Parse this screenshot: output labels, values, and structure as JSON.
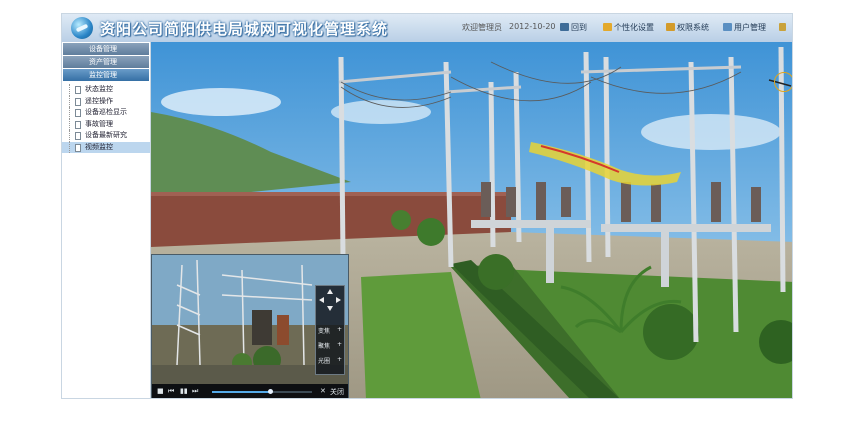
{
  "header": {
    "title": "资阳公司简阳供电局城网可视化管理系统",
    "user": "欢迎管理员",
    "date": "2012-10-20",
    "buttons": [
      {
        "label": "回到",
        "icon": "printer-icon"
      },
      {
        "label": "个性化设置",
        "icon": "folder-icon"
      },
      {
        "label": "权限系统",
        "icon": "key-icon"
      },
      {
        "label": "用户管理",
        "icon": "user-icon"
      }
    ],
    "colors": {
      "header_bg": "#cfdff0",
      "title": "#ffffff"
    }
  },
  "sidebar": {
    "sections": [
      {
        "label": "设备管理"
      },
      {
        "label": "资产管理"
      },
      {
        "label": "监控管理"
      }
    ],
    "items": [
      {
        "label": "状态监控"
      },
      {
        "label": "遥控操作"
      },
      {
        "label": "设备巡检显示"
      },
      {
        "label": "事故管理"
      },
      {
        "label": "设备最新研究"
      },
      {
        "label": "视频监控"
      }
    ],
    "selected_item": "视频监控",
    "colors": {
      "active": "#356fa4",
      "selected_bg": "#bcd6ee"
    }
  },
  "video": {
    "ptz": {
      "rows": [
        {
          "label": "变焦",
          "sign": "+"
        },
        {
          "label": "聚焦",
          "sign": "+"
        },
        {
          "label": "光圈",
          "sign": "+"
        }
      ]
    },
    "controls": {
      "stop": "■",
      "prev": "⏮",
      "pause": "▮▮",
      "next": "⏭",
      "close": "✕",
      "extra": "关闭"
    },
    "progress": 0.58
  }
}
